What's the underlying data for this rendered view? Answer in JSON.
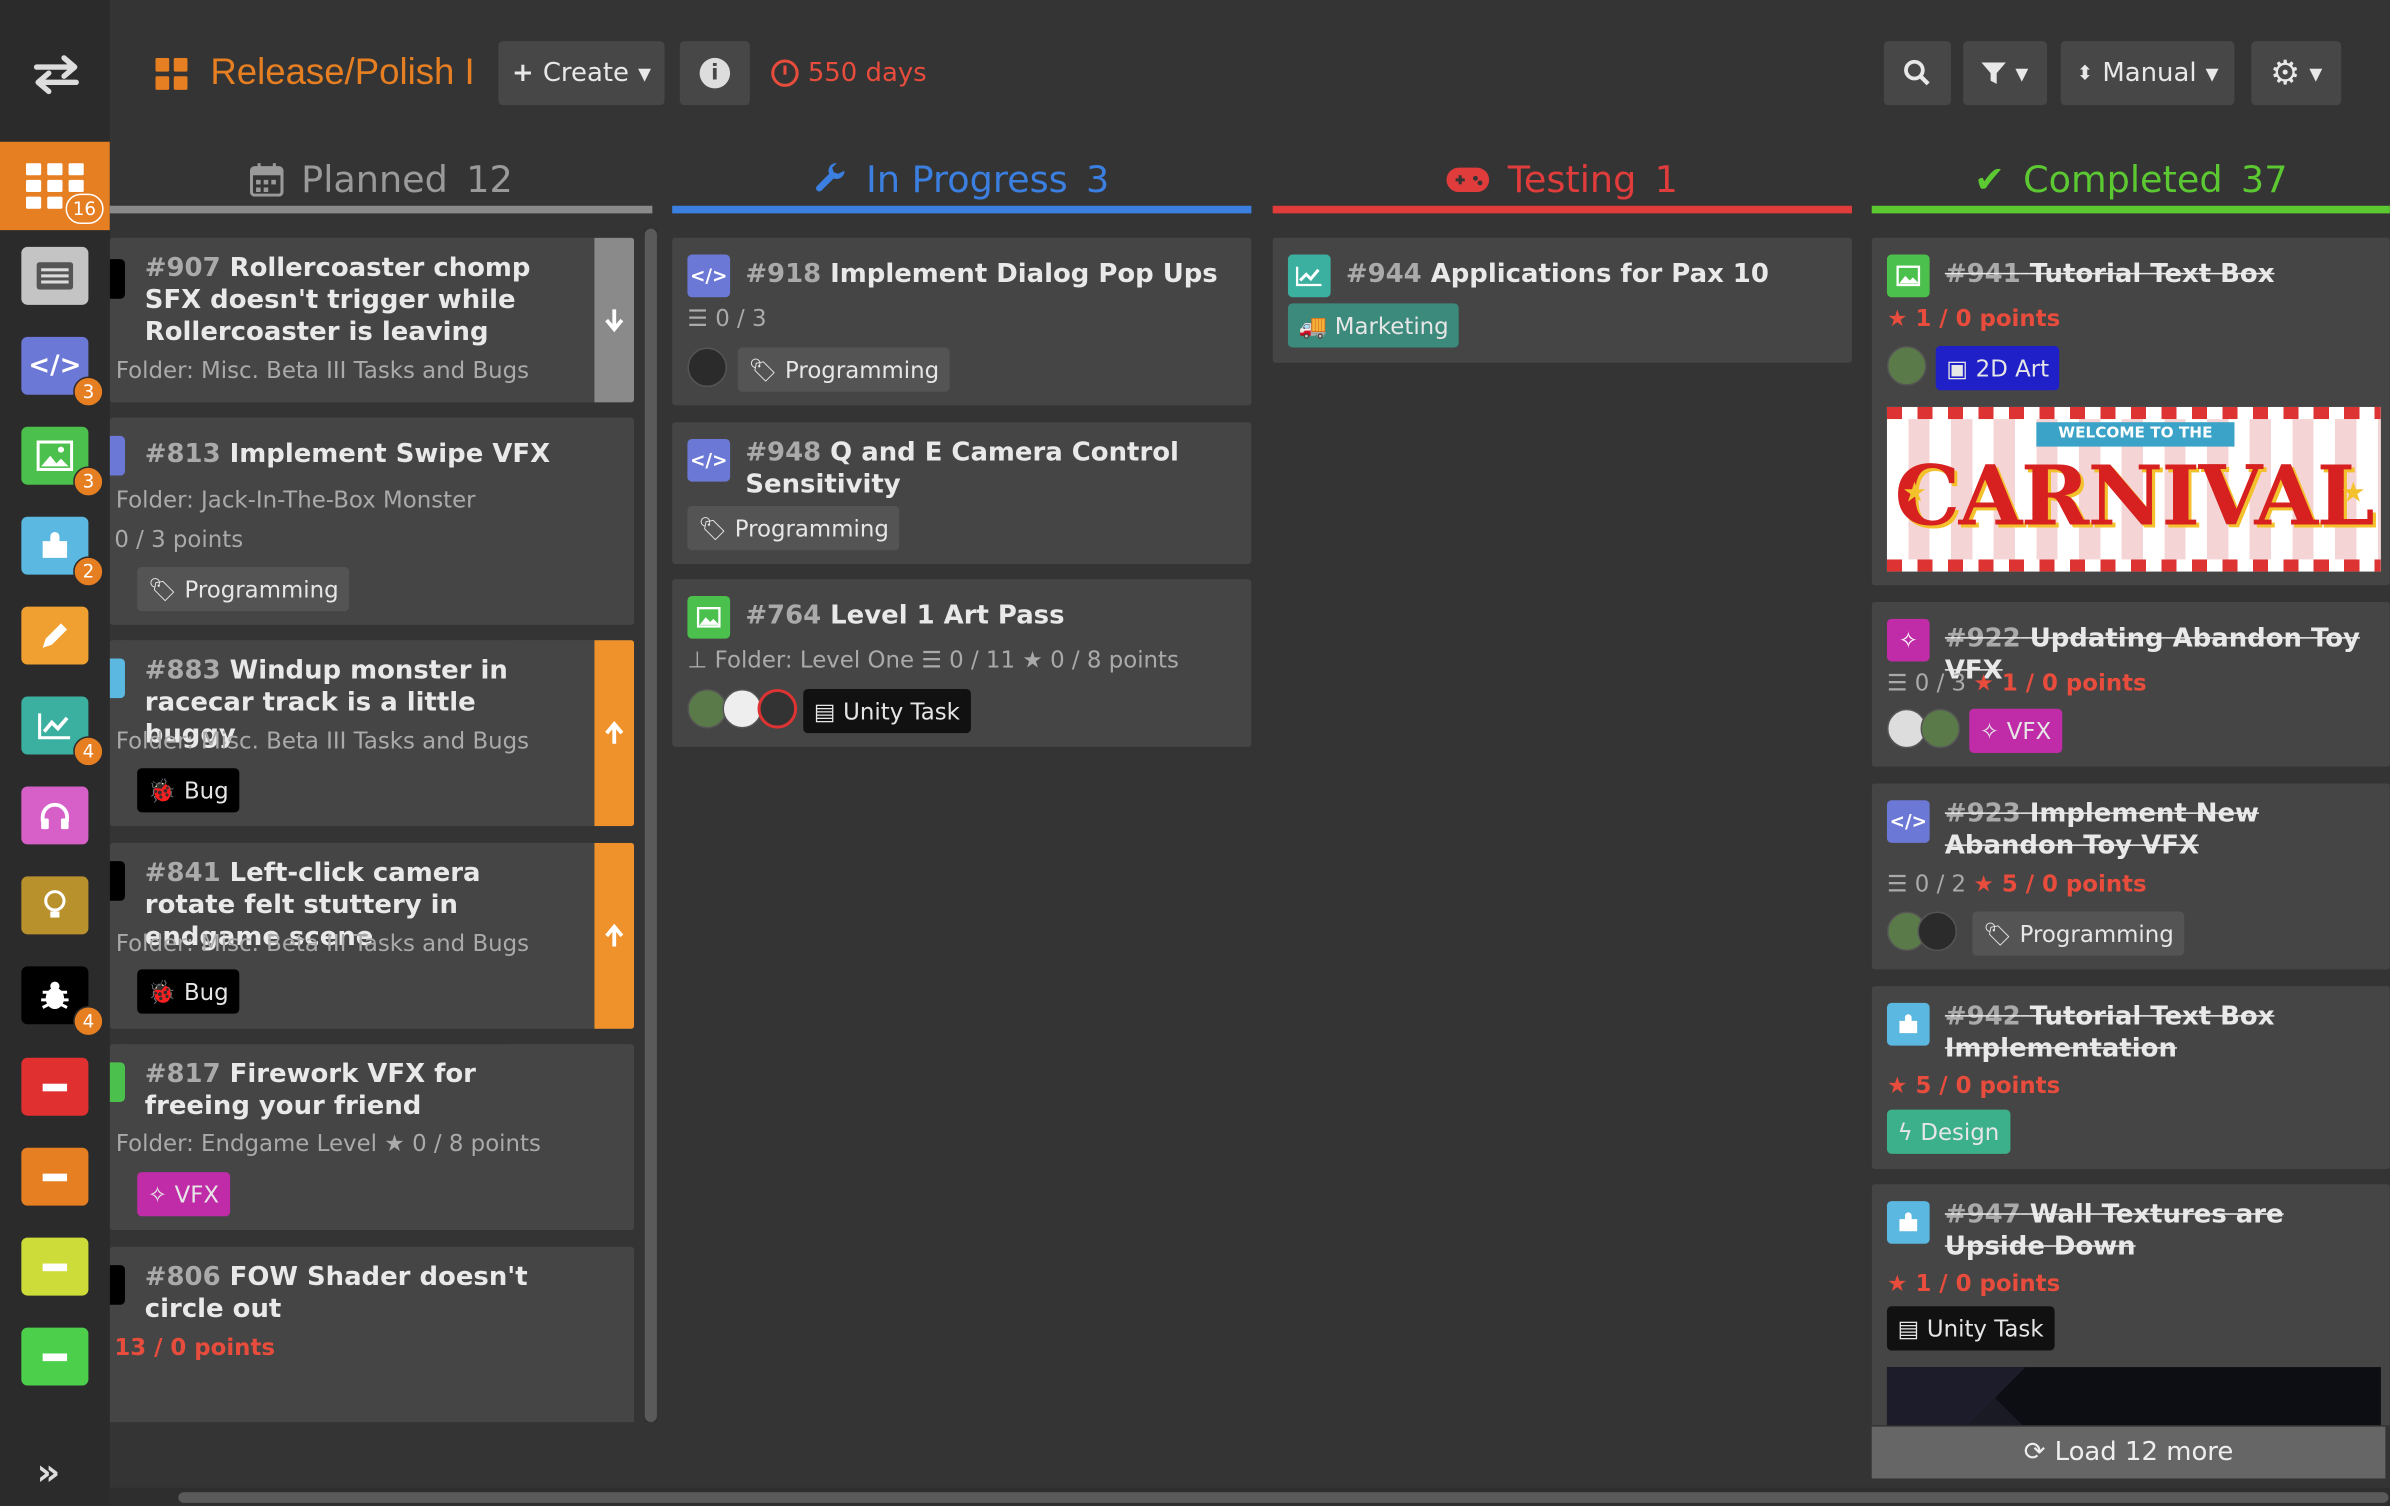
{
  "header": {
    "title": "Release/Polish I",
    "create_label": "Create",
    "days_label": "550 days",
    "sort_label": "Manual"
  },
  "sidebar": {
    "items": [
      {
        "name": "board",
        "color": "#e67e22",
        "badge": "16"
      },
      {
        "name": "backlog",
        "color": "#bdbdbd",
        "badge": ""
      },
      {
        "name": "code",
        "color": "#6c78d6",
        "badge": "3"
      },
      {
        "name": "art",
        "color": "#4cc04c",
        "badge": "3"
      },
      {
        "name": "design",
        "color": "#5bb8e0",
        "badge": "2"
      },
      {
        "name": "writing",
        "color": "#f0a030",
        "badge": ""
      },
      {
        "name": "marketing",
        "color": "#3bb0a0",
        "badge": "4"
      },
      {
        "name": "audio",
        "color": "#d65fc8",
        "badge": ""
      },
      {
        "name": "ideas",
        "color": "#b8902c",
        "badge": ""
      },
      {
        "name": "bugs",
        "color": "#000000",
        "badge": "4"
      },
      {
        "name": "priority-high",
        "color": "#e03030",
        "badge": ""
      },
      {
        "name": "priority-medium",
        "color": "#e67e22",
        "badge": ""
      },
      {
        "name": "priority-low",
        "color": "#cddc39",
        "badge": ""
      },
      {
        "name": "priority-none",
        "color": "#4cd04c",
        "badge": ""
      }
    ]
  },
  "columns": [
    {
      "label": "Planned",
      "count": "12",
      "color": "#8a8a8a"
    },
    {
      "label": "In Progress",
      "count": "3",
      "color": "#3b7fe0"
    },
    {
      "label": "Testing",
      "count": "1",
      "color": "#e03c3c"
    },
    {
      "label": "Completed",
      "count": "37",
      "color": "#5cc832"
    }
  ],
  "planned": [
    {
      "num": "#907",
      "title": "Rollercoaster chomp SFX doesn't trigger while Rollercoaster is leaving",
      "folder": "Folder: Misc. Beta III Tasks and Bugs"
    },
    {
      "num": "#813",
      "title": "Implement Swipe VFX",
      "folder": "Folder: Jack-In-The-Box Monster",
      "points": "0 / 3 points",
      "tag": "Programming"
    },
    {
      "num": "#883",
      "title": "Windup monster in racecar track is a little buggy",
      "folder": "Folder: Misc. Beta III Tasks and Bugs",
      "tag": "Bug"
    },
    {
      "num": "#841",
      "title": "Left-click camera rotate felt stuttery in endgame scene",
      "folder": "Folder: Misc. Beta III Tasks and Bugs",
      "tag": "Bug"
    },
    {
      "num": "#817",
      "title": "Firework VFX for freeing your friend",
      "folder": "Folder: Endgame Level",
      "points": "0 / 8 points",
      "tag": "VFX"
    },
    {
      "num": "#806",
      "title": "FOW Shader doesn't circle out",
      "points": "13 / 0 points"
    }
  ],
  "in_progress": [
    {
      "num": "#918",
      "title": "Implement Dialog Pop Ups",
      "checklist": "0 / 3",
      "tag": "Programming"
    },
    {
      "num": "#948",
      "title": "Q and E Camera Control Sensitivity",
      "tag": "Programming"
    },
    {
      "num": "#764",
      "title": "Level 1 Art Pass",
      "folder": "Folder: Level One",
      "checklist": "0 / 11",
      "points": "0 / 8 points",
      "tag": "Unity Task"
    }
  ],
  "testing": [
    {
      "num": "#944",
      "title": "Applications for Pax 10",
      "tag": "Marketing"
    }
  ],
  "completed": [
    {
      "num": "#941",
      "title": "Tutorial Text Box",
      "points": "1 / 0 points",
      "tag": "2D Art",
      "banner_small": "WELCOME TO THE",
      "banner_big": "CARNIVAL"
    },
    {
      "num": "#922",
      "title": "Updating Abandon Toy VFX",
      "checklist": "0 / 3",
      "points": "1 / 0 points",
      "tag": "VFX"
    },
    {
      "num": "#923",
      "title": "Implement New Abandon Toy VFX",
      "checklist": "0 / 2",
      "points": "5 / 0 points",
      "tag": "Programming"
    },
    {
      "num": "#942",
      "title": "Tutorial Text Box Implementation",
      "points": "5 / 0 points",
      "tag": "Design"
    },
    {
      "num": "#947",
      "title": "Wall Textures are Upside Down",
      "points": "1 / 0 points",
      "tag": "Unity Task"
    }
  ],
  "load_more": "Load 12 more",
  "colors": {
    "accent": "#e67e22",
    "code": "#6c78d6",
    "art": "#4cc04c",
    "design": "#5bb8e0",
    "marketing": "#3bb0a0",
    "vfx": "#c02ca8",
    "bug": "#000000",
    "danger": "#e74c3c"
  }
}
